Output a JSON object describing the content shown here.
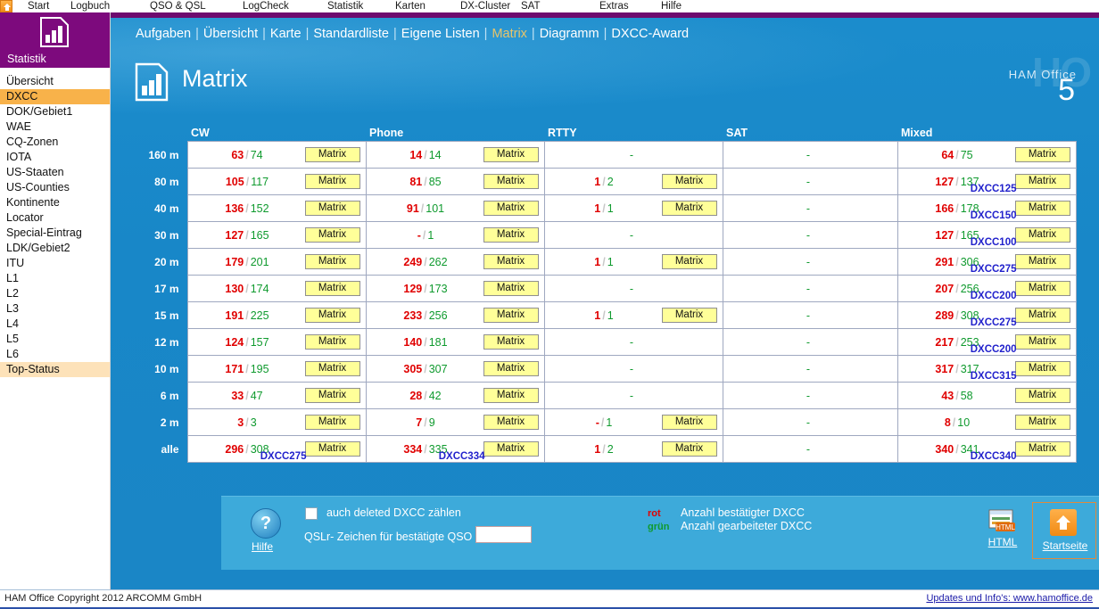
{
  "topmenu": {
    "home_icon": "home-icon",
    "items": [
      "Start",
      "Logbuch",
      "QSO & QSL",
      "LogCheck",
      "Statistik",
      "Karten",
      "DX-Cluster",
      "SAT",
      "Extras",
      "Hilfe"
    ]
  },
  "sidebar": {
    "logo_icon": "statistics-chart-icon",
    "title": "Statistik",
    "items": [
      {
        "label": "Übersicht",
        "state": "normal"
      },
      {
        "label": "DXCC",
        "state": "selected"
      },
      {
        "label": "DOK/Gebiet1",
        "state": "normal"
      },
      {
        "label": "WAE",
        "state": "normal"
      },
      {
        "label": "CQ-Zonen",
        "state": "normal"
      },
      {
        "label": "IOTA",
        "state": "normal"
      },
      {
        "label": "US-Staaten",
        "state": "normal"
      },
      {
        "label": "US-Counties",
        "state": "normal"
      },
      {
        "label": "Kontinente",
        "state": "normal"
      },
      {
        "label": "Locator",
        "state": "normal"
      },
      {
        "label": "Special-Eintrag",
        "state": "normal"
      },
      {
        "label": "LDK/Gebiet2",
        "state": "normal"
      },
      {
        "label": "ITU",
        "state": "normal"
      },
      {
        "label": "L1",
        "state": "normal"
      },
      {
        "label": "L2",
        "state": "normal"
      },
      {
        "label": "L3",
        "state": "normal"
      },
      {
        "label": "L4",
        "state": "normal"
      },
      {
        "label": "L5",
        "state": "normal"
      },
      {
        "label": "L6",
        "state": "normal"
      },
      {
        "label": "Top-Status",
        "state": "highlight"
      }
    ]
  },
  "nav": {
    "items": [
      "Aufgaben",
      "Übersicht",
      "Karte",
      "Standardliste",
      "Eigene Listen",
      "Matrix",
      "Diagramm",
      "DXCC-Award"
    ],
    "active": "Matrix",
    "separator": "|"
  },
  "page": {
    "icon": "statistics-chart-icon",
    "title": "Matrix",
    "watermark": "HO",
    "brand": "HAM Office",
    "version": "5"
  },
  "matrix": {
    "columns": [
      "CW",
      "Phone",
      "RTTY",
      "SAT",
      "Mixed"
    ],
    "button_label": "Matrix",
    "rows": [
      {
        "band": "160 m",
        "cells": [
          {
            "mode": "CW",
            "confirmed": "63",
            "worked": "74",
            "bg": "blue",
            "button": true,
            "badge": ""
          },
          {
            "mode": "Phone",
            "confirmed": "14",
            "worked": "14",
            "bg": "blue",
            "button": true,
            "badge": ""
          },
          {
            "mode": "RTTY",
            "confirmed": "-",
            "worked": "",
            "bg": "white",
            "button": false,
            "badge": ""
          },
          {
            "mode": "SAT",
            "confirmed": "-",
            "worked": "",
            "bg": "white",
            "button": false,
            "badge": ""
          },
          {
            "mode": "Mixed",
            "confirmed": "64",
            "worked": "75",
            "bg": "blue",
            "button": true,
            "badge": ""
          }
        ]
      },
      {
        "band": "80 m",
        "cells": [
          {
            "mode": "CW",
            "confirmed": "105",
            "worked": "117",
            "bg": "blue",
            "button": true,
            "badge": ""
          },
          {
            "mode": "Phone",
            "confirmed": "81",
            "worked": "85",
            "bg": "blue",
            "button": true,
            "badge": ""
          },
          {
            "mode": "RTTY",
            "confirmed": "1",
            "worked": "2",
            "bg": "blue",
            "button": true,
            "badge": ""
          },
          {
            "mode": "SAT",
            "confirmed": "-",
            "worked": "",
            "bg": "white",
            "button": false,
            "badge": ""
          },
          {
            "mode": "Mixed",
            "confirmed": "127",
            "worked": "137",
            "bg": "pink",
            "button": true,
            "badge": "DXCC125"
          }
        ]
      },
      {
        "band": "40 m",
        "cells": [
          {
            "mode": "CW",
            "confirmed": "136",
            "worked": "152",
            "bg": "blue",
            "button": true,
            "badge": ""
          },
          {
            "mode": "Phone",
            "confirmed": "91",
            "worked": "101",
            "bg": "blue",
            "button": true,
            "badge": ""
          },
          {
            "mode": "RTTY",
            "confirmed": "1",
            "worked": "1",
            "bg": "blue",
            "button": true,
            "badge": ""
          },
          {
            "mode": "SAT",
            "confirmed": "-",
            "worked": "",
            "bg": "white",
            "button": false,
            "badge": ""
          },
          {
            "mode": "Mixed",
            "confirmed": "166",
            "worked": "178",
            "bg": "pink",
            "button": true,
            "badge": "DXCC150"
          }
        ]
      },
      {
        "band": "30 m",
        "cells": [
          {
            "mode": "CW",
            "confirmed": "127",
            "worked": "165",
            "bg": "blue",
            "button": true,
            "badge": ""
          },
          {
            "mode": "Phone",
            "confirmed": "-",
            "worked": "1",
            "bg": "blue",
            "button": true,
            "badge": ""
          },
          {
            "mode": "RTTY",
            "confirmed": "-",
            "worked": "",
            "bg": "white",
            "button": false,
            "badge": ""
          },
          {
            "mode": "SAT",
            "confirmed": "-",
            "worked": "",
            "bg": "white",
            "button": false,
            "badge": ""
          },
          {
            "mode": "Mixed",
            "confirmed": "127",
            "worked": "165",
            "bg": "pink",
            "button": true,
            "badge": "DXCC100"
          }
        ]
      },
      {
        "band": "20 m",
        "cells": [
          {
            "mode": "CW",
            "confirmed": "179",
            "worked": "201",
            "bg": "blue",
            "button": true,
            "badge": ""
          },
          {
            "mode": "Phone",
            "confirmed": "249",
            "worked": "262",
            "bg": "blue",
            "button": true,
            "badge": ""
          },
          {
            "mode": "RTTY",
            "confirmed": "1",
            "worked": "1",
            "bg": "blue",
            "button": true,
            "badge": ""
          },
          {
            "mode": "SAT",
            "confirmed": "-",
            "worked": "",
            "bg": "white",
            "button": false,
            "badge": ""
          },
          {
            "mode": "Mixed",
            "confirmed": "291",
            "worked": "306",
            "bg": "pink",
            "button": true,
            "badge": "DXCC275"
          }
        ]
      },
      {
        "band": "17 m",
        "cells": [
          {
            "mode": "CW",
            "confirmed": "130",
            "worked": "174",
            "bg": "blue",
            "button": true,
            "badge": ""
          },
          {
            "mode": "Phone",
            "confirmed": "129",
            "worked": "173",
            "bg": "blue",
            "button": true,
            "badge": ""
          },
          {
            "mode": "RTTY",
            "confirmed": "-",
            "worked": "",
            "bg": "white",
            "button": false,
            "badge": ""
          },
          {
            "mode": "SAT",
            "confirmed": "-",
            "worked": "",
            "bg": "white",
            "button": false,
            "badge": ""
          },
          {
            "mode": "Mixed",
            "confirmed": "207",
            "worked": "256",
            "bg": "pink",
            "button": true,
            "badge": "DXCC200"
          }
        ]
      },
      {
        "band": "15 m",
        "cells": [
          {
            "mode": "CW",
            "confirmed": "191",
            "worked": "225",
            "bg": "blue",
            "button": true,
            "badge": ""
          },
          {
            "mode": "Phone",
            "confirmed": "233",
            "worked": "256",
            "bg": "blue",
            "button": true,
            "badge": ""
          },
          {
            "mode": "RTTY",
            "confirmed": "1",
            "worked": "1",
            "bg": "blue",
            "button": true,
            "badge": ""
          },
          {
            "mode": "SAT",
            "confirmed": "-",
            "worked": "",
            "bg": "white",
            "button": false,
            "badge": ""
          },
          {
            "mode": "Mixed",
            "confirmed": "289",
            "worked": "308",
            "bg": "pink",
            "button": true,
            "badge": "DXCC275"
          }
        ]
      },
      {
        "band": "12 m",
        "cells": [
          {
            "mode": "CW",
            "confirmed": "124",
            "worked": "157",
            "bg": "blue",
            "button": true,
            "badge": ""
          },
          {
            "mode": "Phone",
            "confirmed": "140",
            "worked": "181",
            "bg": "blue",
            "button": true,
            "badge": ""
          },
          {
            "mode": "RTTY",
            "confirmed": "-",
            "worked": "",
            "bg": "white",
            "button": false,
            "badge": ""
          },
          {
            "mode": "SAT",
            "confirmed": "-",
            "worked": "",
            "bg": "white",
            "button": false,
            "badge": ""
          },
          {
            "mode": "Mixed",
            "confirmed": "217",
            "worked": "253",
            "bg": "pink",
            "button": true,
            "badge": "DXCC200"
          }
        ]
      },
      {
        "band": "10 m",
        "cells": [
          {
            "mode": "CW",
            "confirmed": "171",
            "worked": "195",
            "bg": "blue",
            "button": true,
            "badge": ""
          },
          {
            "mode": "Phone",
            "confirmed": "305",
            "worked": "307",
            "bg": "blue",
            "button": true,
            "badge": ""
          },
          {
            "mode": "RTTY",
            "confirmed": "-",
            "worked": "",
            "bg": "white",
            "button": false,
            "badge": ""
          },
          {
            "mode": "SAT",
            "confirmed": "-",
            "worked": "",
            "bg": "white",
            "button": false,
            "badge": ""
          },
          {
            "mode": "Mixed",
            "confirmed": "317",
            "worked": "317",
            "bg": "pink",
            "button": true,
            "badge": "DXCC315"
          }
        ]
      },
      {
        "band": "6 m",
        "cells": [
          {
            "mode": "CW",
            "confirmed": "33",
            "worked": "47",
            "bg": "blue",
            "button": true,
            "badge": ""
          },
          {
            "mode": "Phone",
            "confirmed": "28",
            "worked": "42",
            "bg": "blue",
            "button": true,
            "badge": ""
          },
          {
            "mode": "RTTY",
            "confirmed": "-",
            "worked": "",
            "bg": "white",
            "button": false,
            "badge": ""
          },
          {
            "mode": "SAT",
            "confirmed": "-",
            "worked": "",
            "bg": "white",
            "button": false,
            "badge": ""
          },
          {
            "mode": "Mixed",
            "confirmed": "43",
            "worked": "58",
            "bg": "blue",
            "button": true,
            "badge": ""
          }
        ]
      },
      {
        "band": "2 m",
        "cells": [
          {
            "mode": "CW",
            "confirmed": "3",
            "worked": "3",
            "bg": "blue",
            "button": true,
            "badge": ""
          },
          {
            "mode": "Phone",
            "confirmed": "7",
            "worked": "9",
            "bg": "blue",
            "button": true,
            "badge": ""
          },
          {
            "mode": "RTTY",
            "confirmed": "-",
            "worked": "1",
            "bg": "blue",
            "button": true,
            "badge": ""
          },
          {
            "mode": "SAT",
            "confirmed": "-",
            "worked": "",
            "bg": "white",
            "button": false,
            "badge": ""
          },
          {
            "mode": "Mixed",
            "confirmed": "8",
            "worked": "10",
            "bg": "blue",
            "button": true,
            "badge": ""
          }
        ]
      },
      {
        "band": "alle",
        "cells": [
          {
            "mode": "CW",
            "confirmed": "296",
            "worked": "308",
            "bg": "pink",
            "button": true,
            "badge": "DXCC275"
          },
          {
            "mode": "Phone",
            "confirmed": "334",
            "worked": "335",
            "bg": "pink",
            "button": true,
            "badge": "DXCC334"
          },
          {
            "mode": "RTTY",
            "confirmed": "1",
            "worked": "2",
            "bg": "blue",
            "button": true,
            "badge": ""
          },
          {
            "mode": "SAT",
            "confirmed": "-",
            "worked": "",
            "bg": "white",
            "button": false,
            "badge": ""
          },
          {
            "mode": "Mixed",
            "confirmed": "340",
            "worked": "341",
            "bg": "pink",
            "button": true,
            "badge": "DXCC340"
          }
        ]
      }
    ]
  },
  "footer": {
    "help_icon": "help-question-icon",
    "help_label": "Hilfe",
    "checkbox_label": "auch deleted DXCC zählen",
    "checkbox_checked": false,
    "qsl_label": "QSLr- Zeichen für bestätigte QSO",
    "qsl_value": "",
    "legend": [
      {
        "key": "rot",
        "key_color": "#e00000",
        "text": "Anzahl bestätigter DXCC"
      },
      {
        "key": "grün",
        "key_color": "#0f9a2e",
        "text": "Anzahl gearbeiteter DXCC"
      }
    ],
    "html_icon": "html-export-icon",
    "html_label": "HTML",
    "home_icon": "home-icon",
    "home_label": "Startseite"
  },
  "statusbar": {
    "copyright": "HAM Office Copyright 2012 ARCOMM GmbH",
    "link": "Updates und Info's: www.hamoffice.de"
  },
  "colors": {
    "accent_purple": "#7d0a7d",
    "accent_orange": "#f8b24a",
    "panel_blue": "#1887c8",
    "cell_blue": "#dfe6f7",
    "cell_pink": "#fcc3c3",
    "button_yellow": "#ffff99",
    "red": "#e00000",
    "green": "#0f9a2e",
    "badge_blue": "#2222cc"
  }
}
